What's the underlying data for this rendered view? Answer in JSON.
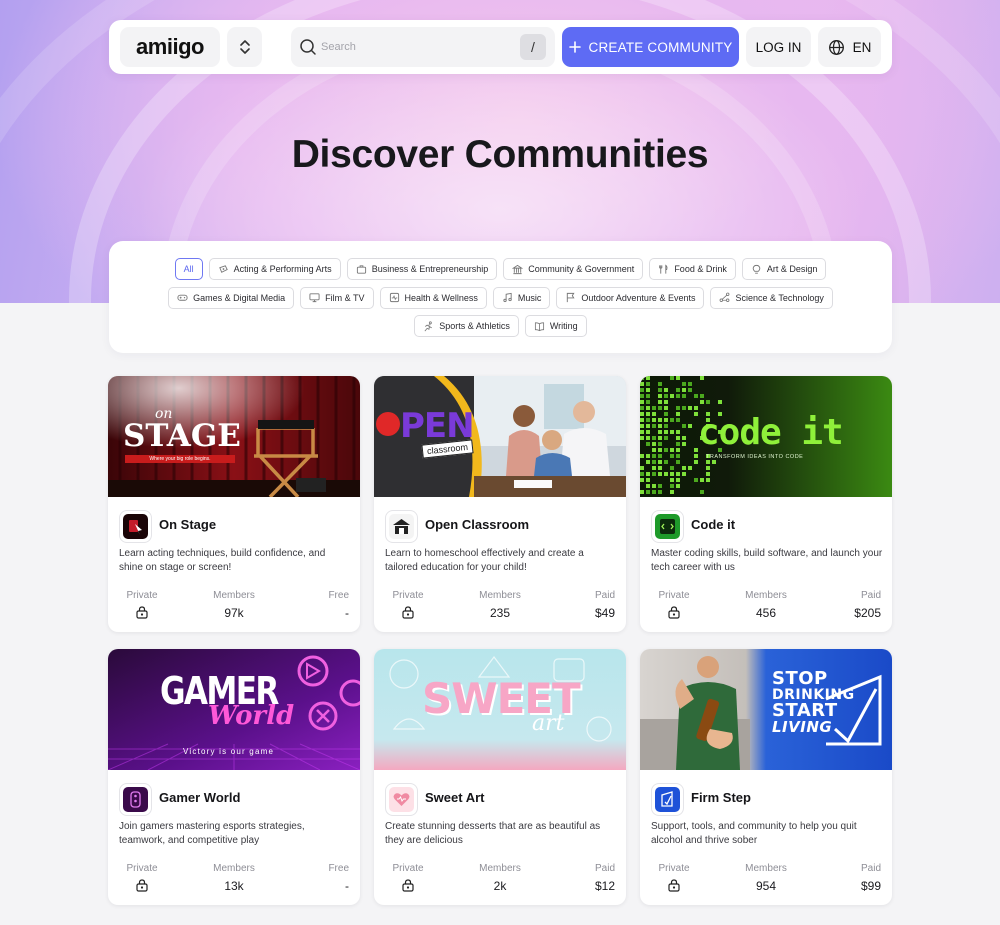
{
  "nav": {
    "logo": "amiigo",
    "search_placeholder": "Search",
    "search_shortcut": "/",
    "create_label": "CREATE COMMUNITY",
    "login_label": "LOG IN",
    "lang_label": "EN"
  },
  "page_title": "Discover Communities",
  "filters": {
    "rows": [
      [
        {
          "label": "All",
          "icon": "none",
          "active": true
        },
        {
          "label": "Acting & Performing Arts",
          "icon": "ticket-icon"
        },
        {
          "label": "Business & Entrepreneurship",
          "icon": "briefcase-icon"
        },
        {
          "label": "Community & Government",
          "icon": "building-icon"
        },
        {
          "label": "Food & Drink",
          "icon": "utensils-icon"
        },
        {
          "label": "Art & Design",
          "icon": "bulb-icon"
        }
      ],
      [
        {
          "label": "Games & Digital Media",
          "icon": "gamepad-icon"
        },
        {
          "label": "Film & TV",
          "icon": "monitor-icon"
        },
        {
          "label": "Health & Wellness",
          "icon": "heart-pulse-icon"
        },
        {
          "label": "Music",
          "icon": "music-icon"
        },
        {
          "label": "Outdoor Adventure & Events",
          "icon": "flag-icon"
        },
        {
          "label": "Science & Technology",
          "icon": "network-icon"
        }
      ],
      [
        {
          "label": "Sports & Athletics",
          "icon": "runner-icon"
        },
        {
          "label": "Writing",
          "icon": "book-icon"
        }
      ]
    ]
  },
  "cards": [
    {
      "name": "On Stage",
      "banner": {
        "title": "STAGE",
        "script": "on",
        "tagline": "Where your big role begins."
      },
      "description": "Learn acting techniques, build confidence, and shine on stage or screen!",
      "stats": {
        "privacy_label": "Private",
        "members_label": "Members",
        "members": "97k",
        "price_label": "Free",
        "price": "-"
      }
    },
    {
      "name": "Open Classroom",
      "banner": {
        "title": "PEN",
        "script": "classroom"
      },
      "description": "Learn to homeschool effectively and create a tailored education for your child!",
      "stats": {
        "privacy_label": "Private",
        "members_label": "Members",
        "members": "235",
        "price_label": "Paid",
        "price": "$49"
      }
    },
    {
      "name": "Code it",
      "banner": {
        "title": "code it",
        "tagline": "TRANSFORM IDEAS INTO CODE"
      },
      "description": "Master coding skills, build software, and launch your tech career with us",
      "stats": {
        "privacy_label": "Private",
        "members_label": "Members",
        "members": "456",
        "price_label": "Paid",
        "price": "$205"
      }
    },
    {
      "name": "Gamer World",
      "banner": {
        "title": "GAMER",
        "script": "World",
        "tagline": "Victory is our game"
      },
      "description": "Join gamers mastering esports strategies, teamwork, and competitive play",
      "stats": {
        "privacy_label": "Private",
        "members_label": "Members",
        "members": "13k",
        "price_label": "Free",
        "price": "-"
      }
    },
    {
      "name": "Sweet Art",
      "banner": {
        "title": "SWEET",
        "script": "art"
      },
      "description": "Create stunning desserts that are as beautiful as they are delicious",
      "stats": {
        "privacy_label": "Private",
        "members_label": "Members",
        "members": "2k",
        "price_label": "Paid",
        "price": "$12"
      }
    },
    {
      "name": "Firm Step",
      "banner": {
        "title_lines": [
          "STOP",
          "DRINKING",
          "START",
          "LIVING"
        ]
      },
      "description": "Support, tools, and community to help you quit alcohol and thrive sober",
      "stats": {
        "privacy_label": "Private",
        "members_label": "Members",
        "members": "954",
        "price_label": "Paid",
        "price": "$99"
      }
    }
  ],
  "colors": {
    "accent": "#5e6bf4",
    "logo_accent": "#e33a55",
    "background": "#f4f4f6"
  }
}
